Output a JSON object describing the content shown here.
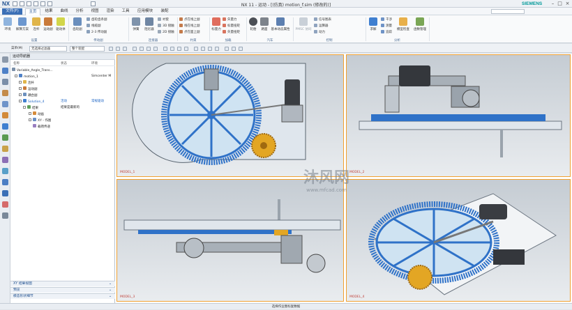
{
  "app": {
    "logo": "NX",
    "window_title": "NX 11 - 运动 - [(仿真) motion_f.sim  (修改的)]",
    "brand": "SIEMENS",
    "window_controls": [
      "–",
      "□",
      "×"
    ]
  },
  "menu": {
    "file_label": "文件(F)",
    "tabs": [
      "主页",
      "结果",
      "曲线",
      "分析",
      "视图",
      "渲染",
      "工具",
      "应用模块",
      "装配"
    ],
    "active_tab": "主页"
  },
  "ribbon": {
    "groups": [
      {
        "label": "设置",
        "buttons": [
          "环境",
          "解算方案",
          "连杆",
          "运动副",
          "驱动体"
        ]
      },
      {
        "label": "传动副",
        "buttons": [
          "齿轮副",
          "齿轮齿条副",
          "线缆副",
          "2-3 传动副",
          "齿轮"
        ]
      },
      {
        "label": "连接器",
        "buttons": [
          "弹簧",
          "阻尼器",
          "衬套",
          "3D 接触",
          "2D 接触"
        ]
      },
      {
        "label": "约束",
        "buttons": [
          "点在线上副",
          "线在线上副",
          "点在面上副"
        ]
      },
      {
        "label": "加载",
        "buttons": [
          "标量力",
          "矢量力",
          "标量扭矩",
          "矢量扭矩",
          "标记"
        ]
      },
      {
        "label": "汽车",
        "buttons": [
          "轮胎",
          "路面",
          "道路",
          "基本动态属性"
        ]
      },
      {
        "label": "控制",
        "buttons": [
          "PMSC 协同",
          "信号图表",
          "运算器",
          "动力"
        ]
      },
      {
        "label": "分析",
        "buttons": [
          "求解",
          "干涉",
          "测量",
          "追踪",
          "模型检查",
          "函数管理"
        ]
      }
    ]
  },
  "toolbar2": {
    "menu_label": "菜单(M)",
    "filter_select": "无选择过滤器",
    "scope_select": "整个装配"
  },
  "navigator": {
    "title": "运动导航器",
    "columns": [
      "名称",
      "状态",
      "环境"
    ],
    "rows": [
      {
        "name": "Variable_Angle_Trans...",
        "status": "",
        "env": ""
      },
      {
        "name": "motion_1",
        "status": "",
        "env": "Simcenter M"
      },
      {
        "name": "连杆",
        "status": "",
        "env": ""
      },
      {
        "name": "运动副",
        "status": "",
        "env": ""
      },
      {
        "name": "耦合副",
        "status": "",
        "env": ""
      },
      {
        "name": "Solution_4",
        "status": "活动",
        "env": "常规驱动"
      },
      {
        "name": "结果",
        "status": "结果是最新的",
        "env": ""
      },
      {
        "name": "动画",
        "status": "",
        "env": ""
      },
      {
        "name": "XY - 作图",
        "status": "",
        "env": ""
      },
      {
        "name": "载荷传递",
        "status": "",
        "env": ""
      }
    ],
    "bottom_panels": [
      "XY 结果视图",
      "预览",
      "模态形状细节"
    ]
  },
  "viewports": [
    {
      "label": "MODEL_1",
      "view": "top"
    },
    {
      "label": "MODEL_2",
      "view": "front"
    },
    {
      "label": "MODEL_3",
      "view": "side"
    },
    {
      "label": "MODEL_4",
      "view": "iso"
    }
  ],
  "watermark": {
    "text": "沐风网",
    "url": "www.mfcad.com"
  },
  "status_text": "选择作业图标复数据",
  "colors": {
    "gear_blue": "#2f72c8",
    "gear_gold": "#e3a624",
    "highlight": "#f0a030",
    "accent": "#3b6fb6"
  }
}
